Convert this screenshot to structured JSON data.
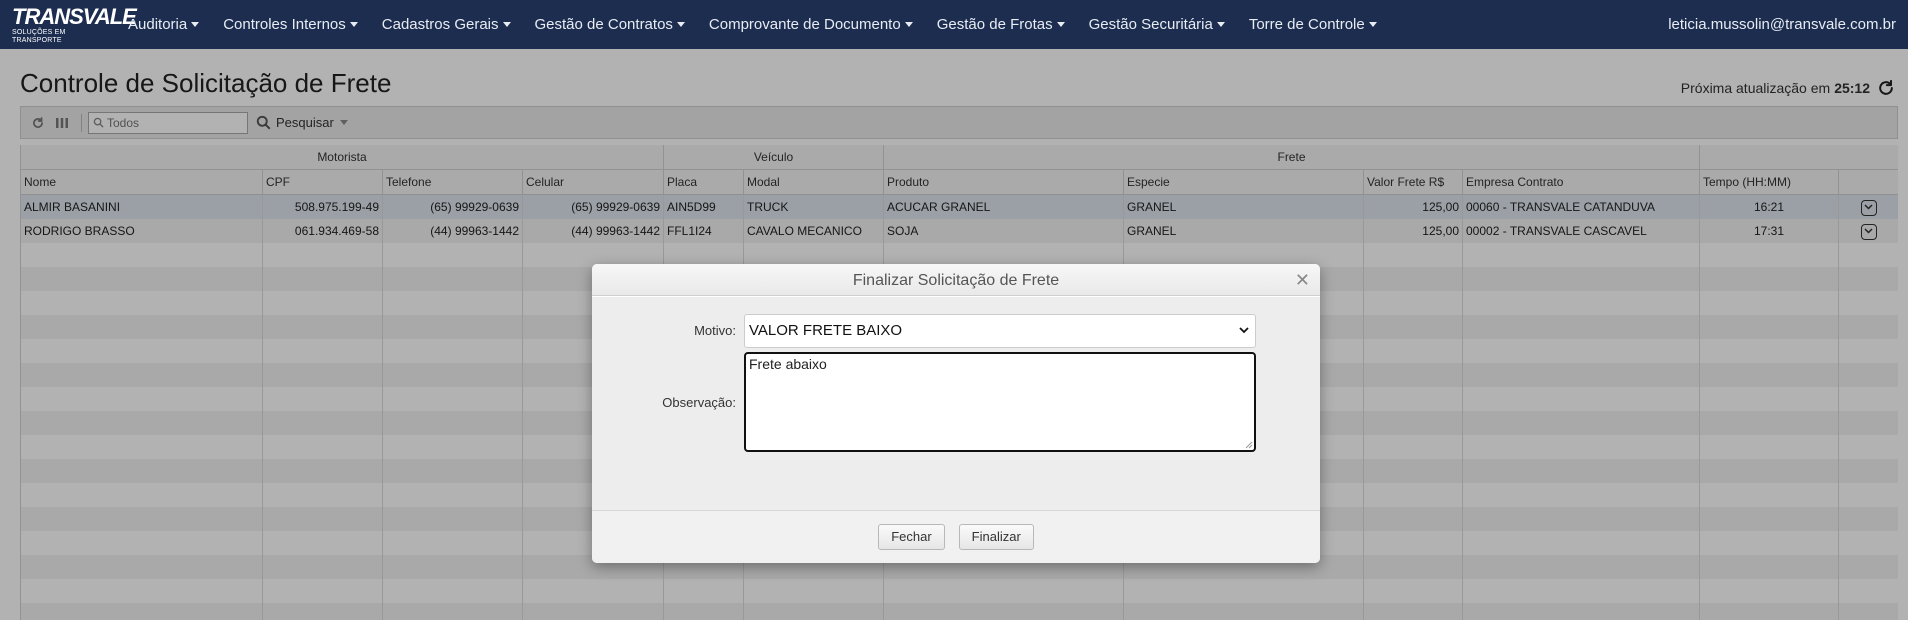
{
  "navbar": {
    "logo_text": "TRANSVALE",
    "logo_sub": "SOLUÇÕES EM TRANSPORTE",
    "menu": [
      {
        "label": "Auditoria"
      },
      {
        "label": "Controles Internos"
      },
      {
        "label": "Cadastros Gerais"
      },
      {
        "label": "Gestão de Contratos"
      },
      {
        "label": "Comprovante de Documento"
      },
      {
        "label": "Gestão de Frotas"
      },
      {
        "label": "Gestão Securitária"
      },
      {
        "label": "Torre de Controle"
      }
    ],
    "user": "leticia.mussolin@transvale.com.br"
  },
  "page": {
    "title": "Controle de Solicitação de Frete",
    "refresh_label": "Próxima atualização em",
    "refresh_time": "25:12"
  },
  "toolbar": {
    "search_placeholder": "Todos",
    "search_button": "Pesquisar"
  },
  "grid": {
    "groups": [
      "Motorista",
      "Veículo",
      "Frete",
      ""
    ],
    "columns": [
      "Nome",
      "CPF",
      "Telefone",
      "Celular",
      "Placa",
      "Modal",
      "Produto",
      "Especie",
      "Valor Frete R$",
      "Empresa Contrato",
      "Tempo (HH:MM)",
      ""
    ],
    "rows": [
      [
        "ALMIR BASANINI",
        "508.975.199-49",
        "(65) 99929-0639",
        "(65) 99929-0639",
        "AIN5D99",
        "TRUCK",
        "ACUCAR GRANEL",
        "GRANEL",
        "125,00",
        "00060 - TRANSVALE CATANDUVA",
        "16:21"
      ],
      [
        "RODRIGO BRASSO",
        "061.934.469-58",
        "(44) 99963-1442",
        "(44) 99963-1442",
        "FFL1I24",
        "CAVALO MECANICO",
        "SOJA",
        "GRANEL",
        "125,00",
        "00002 - TRANSVALE CASCAVEL",
        "17:31"
      ]
    ]
  },
  "modal": {
    "title": "Finalizar Solicitação de Frete",
    "motivo_label": "Motivo:",
    "motivo_value": "VALOR FRETE BAIXO",
    "observacao_label": "Observação:",
    "observacao_value": "Frete abaixo",
    "close_button": "Fechar",
    "finish_button": "Finalizar"
  }
}
